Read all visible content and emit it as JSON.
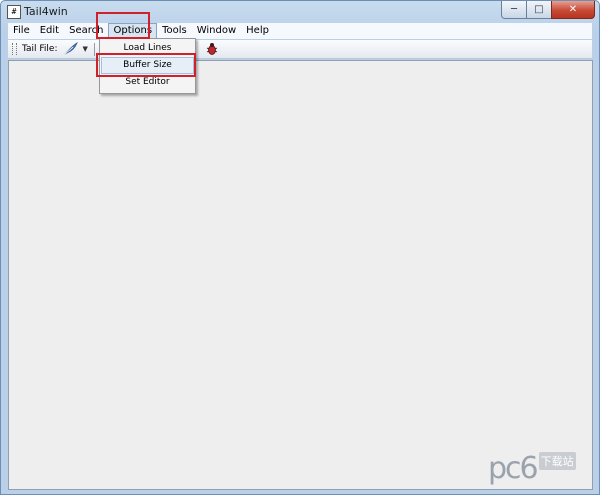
{
  "window": {
    "title": "Tail4win",
    "app_icon_glyph": "#",
    "controls": {
      "minimize": "─",
      "maximize": "□",
      "close": "✕"
    }
  },
  "menubar": {
    "items": [
      {
        "label": "File"
      },
      {
        "label": "Edit"
      },
      {
        "label": "Search"
      },
      {
        "label": "Options"
      },
      {
        "label": "Tools"
      },
      {
        "label": "Window"
      },
      {
        "label": "Help"
      }
    ],
    "active": "Options"
  },
  "toolbar": {
    "tail_file_label": "Tail File:",
    "tail_icon": "feather-icon",
    "dropdown_glyph": "▼",
    "bug_icon": "bug-icon"
  },
  "options_menu": {
    "items": [
      {
        "label": "Load Lines"
      },
      {
        "label": "Buffer Size"
      },
      {
        "label": "Set Editor"
      }
    ],
    "highlighted": "Buffer Size"
  },
  "annotation": {
    "color": "#d0202b"
  },
  "watermark": {
    "logo": "pc6",
    "text": "下载站"
  },
  "colors": {
    "chrome": "#b9d0e8",
    "content_bg": "#eeeeee",
    "close_button": "#c74a36"
  }
}
